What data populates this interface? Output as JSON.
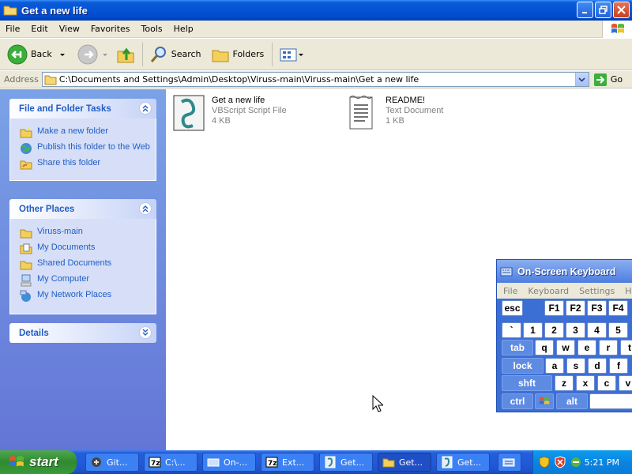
{
  "window": {
    "title": "Get a new life"
  },
  "menu": [
    "File",
    "Edit",
    "View",
    "Favorites",
    "Tools",
    "Help"
  ],
  "toolbar": {
    "back": "Back",
    "search": "Search",
    "folders": "Folders"
  },
  "address": {
    "label": "Address",
    "value": "C:\\Documents and Settings\\Admin\\Desktop\\Viruss-main\\Viruss-main\\Get a new life",
    "go": "Go"
  },
  "sidebar": {
    "tasks": {
      "title": "File and Folder Tasks",
      "items": [
        "Make a new folder",
        "Publish this folder to the Web",
        "Share this folder"
      ]
    },
    "places": {
      "title": "Other Places",
      "items": [
        "Viruss-main",
        "My Documents",
        "Shared Documents",
        "My Computer",
        "My Network Places"
      ]
    },
    "details": {
      "title": "Details"
    }
  },
  "files": [
    {
      "name": "Get a new life",
      "type": "VBScript Script File",
      "size": "4 KB"
    },
    {
      "name": "README!",
      "type": "Text Document",
      "size": "1 KB"
    }
  ],
  "osk": {
    "title": "On-Screen Keyboard",
    "menu": [
      "File",
      "Keyboard",
      "Settings",
      "Help"
    ],
    "rows": {
      "r1": [
        "esc",
        "F1",
        "F2",
        "F3",
        "F4"
      ],
      "r2": [
        "`",
        "1",
        "2",
        "3",
        "4",
        "5"
      ],
      "r3": [
        "tab",
        "q",
        "w",
        "e",
        "r",
        "t"
      ],
      "r4": [
        "lock",
        "a",
        "s",
        "d",
        "f"
      ],
      "r5": [
        "shft",
        "z",
        "x",
        "c",
        "v"
      ],
      "r6": [
        "ctrl",
        "alt"
      ]
    }
  },
  "taskbar": {
    "start": "start",
    "buttons": [
      "Git...",
      "C:\\...",
      "On-...",
      "Ext...",
      "Get...",
      "Get...",
      "Get..."
    ],
    "clock": "5:21 PM"
  }
}
